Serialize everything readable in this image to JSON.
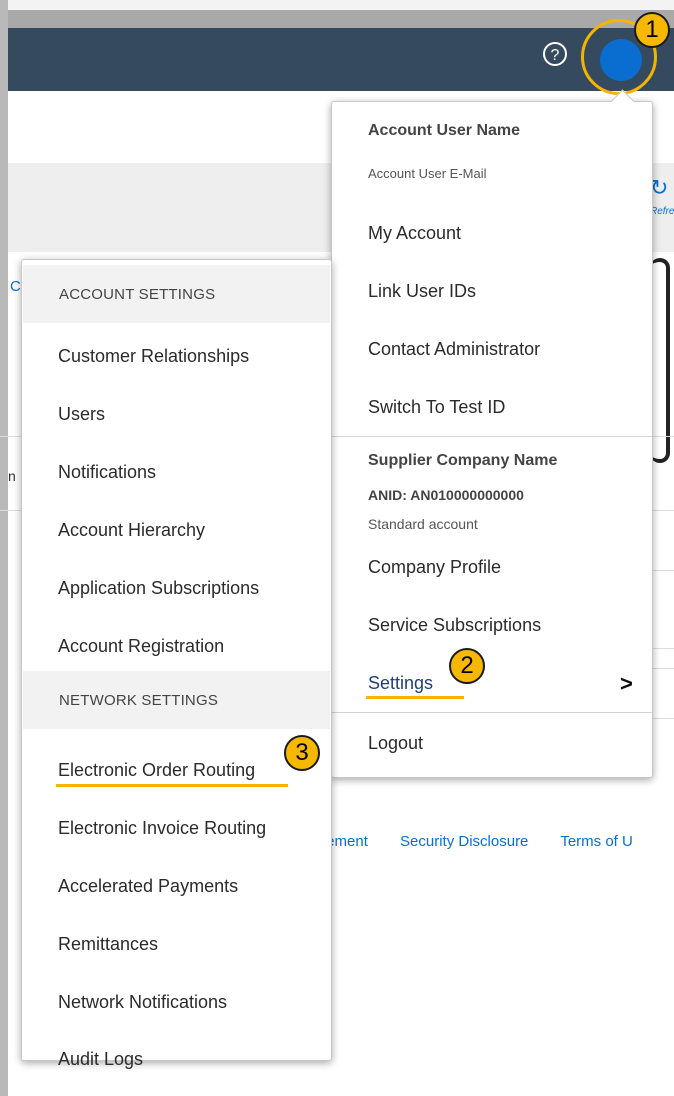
{
  "header": {
    "help_icon": "help-icon",
    "avatar_icon": "user-avatar"
  },
  "background": {
    "refresh_label": "Refres",
    "footer": [
      "tement",
      "Security Disclosure",
      "Terms of U"
    ],
    "partial_letter_c": "C",
    "partial_letter_n": "n"
  },
  "annotations": {
    "step1": "1",
    "step2": "2",
    "step3": "3",
    "highlight_color": "#f5b400"
  },
  "account_menu": {
    "user_name": "Account User Name",
    "user_email": "Account User E-Mail",
    "items_top": [
      "My Account",
      "Link User IDs",
      "Contact Administrator",
      "Switch To Test ID"
    ],
    "company_name": "Supplier Company Name",
    "anid": "ANID: AN010000000000",
    "account_type": "Standard account",
    "company_profile": "Company Profile",
    "service_subscriptions": "Service Subscriptions",
    "settings": "Settings",
    "settings_chevron": ">",
    "logout": "Logout"
  },
  "settings_menu": {
    "account_settings_header": "ACCOUNT SETTINGS",
    "account_items": [
      "Customer Relationships",
      "Users",
      "Notifications",
      "Account Hierarchy",
      "Application Subscriptions",
      "Account Registration"
    ],
    "network_settings_header": "NETWORK SETTINGS",
    "network_items": [
      "Electronic Order Routing",
      "Electronic Invoice Routing",
      "Accelerated Payments",
      "Remittances",
      "Network Notifications",
      "Audit Logs"
    ]
  }
}
